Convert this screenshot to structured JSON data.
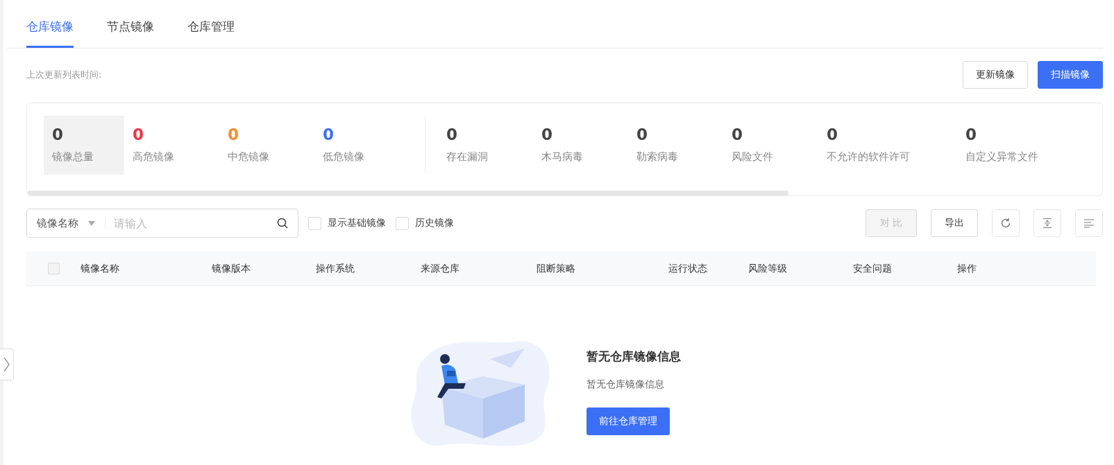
{
  "tabs": [
    {
      "label": "仓库镜像",
      "selected": true
    },
    {
      "label": "节点镜像",
      "selected": false
    },
    {
      "label": "仓库管理",
      "selected": false
    }
  ],
  "last_update_label": "上次更新列表时间:",
  "header_buttons": [
    {
      "label": "更新镜像",
      "kind": "default"
    },
    {
      "label": "扫描镜像",
      "kind": "primary"
    }
  ],
  "stat_groups": [
    [
      {
        "value": "0",
        "label": "镜像总量",
        "color": "#444444",
        "selected": true
      },
      {
        "value": "0",
        "label": "高危镜像",
        "color": "#f5333f",
        "selected": false
      },
      {
        "value": "0",
        "label": "中危镜像",
        "color": "#ff8a2c",
        "selected": false
      },
      {
        "value": "0",
        "label": "低危镜像",
        "color": "#3b6ff5",
        "selected": false
      }
    ],
    [
      {
        "value": "0",
        "label": "存在漏洞",
        "color": "#444444",
        "selected": false
      },
      {
        "value": "0",
        "label": "木马病毒",
        "color": "#444444",
        "selected": false
      },
      {
        "value": "0",
        "label": "勒索病毒",
        "color": "#444444",
        "selected": false
      },
      {
        "value": "0",
        "label": "风险文件",
        "color": "#444444",
        "selected": false
      },
      {
        "value": "0",
        "label": "不允许的软件许可",
        "color": "#444444",
        "selected": false
      },
      {
        "value": "0",
        "label": "自定义异常文件",
        "color": "#444444",
        "selected": false
      }
    ]
  ],
  "search": {
    "filter": "镜像名称",
    "placeholder": "请输入"
  },
  "checkboxes": [
    {
      "label": "显示基础镜像",
      "checked": false
    },
    {
      "label": "历史镜像",
      "checked": false
    }
  ],
  "toolbar_buttons": [
    {
      "label": "对 比",
      "disabled": true
    },
    {
      "label": "导出",
      "disabled": false
    }
  ],
  "table": {
    "select_all_checked": false,
    "columns": [
      "镜像名称",
      "镜像版本",
      "操作系统",
      "来源仓库",
      "阻断策略",
      "运行状态",
      "风险等级",
      "安全问题",
      "操作"
    ]
  },
  "empty_state": {
    "title": "暂无仓库镜像信息",
    "description": "暂无仓库镜像信息",
    "button": "前往仓库管理"
  }
}
